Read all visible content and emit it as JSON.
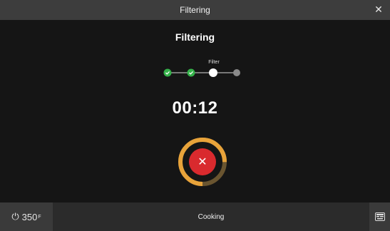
{
  "window": {
    "title": "Filtering",
    "close_icon": "close-icon"
  },
  "main": {
    "heading": "Filtering",
    "current_step_label": "Filter",
    "timer": "00:12",
    "stop_icon": "close-icon",
    "steps": [
      {
        "state": "done",
        "color": "#35b24a"
      },
      {
        "state": "done",
        "color": "#35b24a"
      },
      {
        "state": "current",
        "color": "#ffffff"
      },
      {
        "state": "pending",
        "color": "#8a8a8a"
      }
    ],
    "ring": {
      "progress": 0.75,
      "progress_color": "#e8a33a",
      "track_color": "#6a5530"
    }
  },
  "bottom": {
    "power_value": "350",
    "power_unit": "F",
    "cooking_label": "Cooking",
    "right_icon": "keyboard-icon",
    "progress_color": "#2f8be8"
  }
}
